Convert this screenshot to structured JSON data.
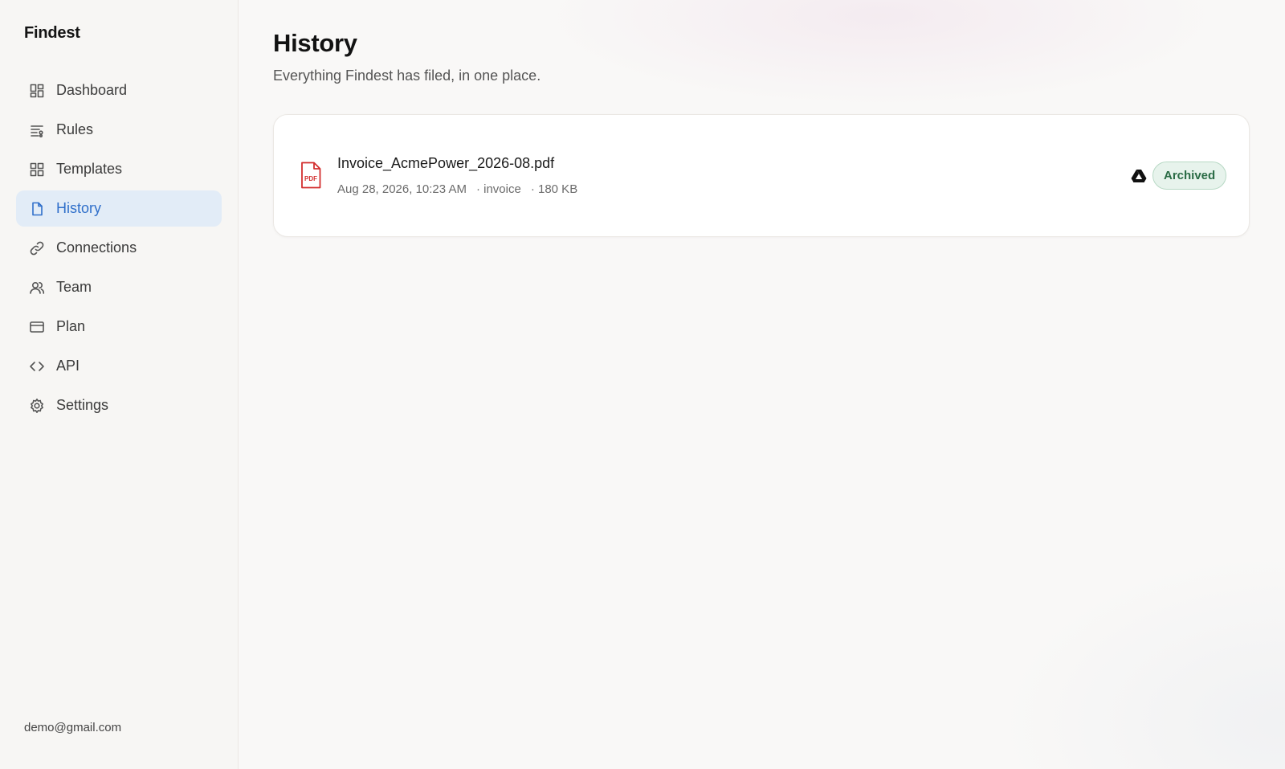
{
  "app": {
    "brand": "Findest"
  },
  "sidebar": {
    "items": [
      {
        "label": "Dashboard",
        "icon": "dashboard-icon",
        "active": false
      },
      {
        "label": "Rules",
        "icon": "rules-icon",
        "active": false
      },
      {
        "label": "Templates",
        "icon": "templates-icon",
        "active": false
      },
      {
        "label": "History",
        "icon": "file-icon",
        "active": true
      },
      {
        "label": "Connections",
        "icon": "link-icon",
        "active": false
      },
      {
        "label": "Team",
        "icon": "users-icon",
        "active": false
      },
      {
        "label": "Plan",
        "icon": "credit-card-icon",
        "active": false
      },
      {
        "label": "API",
        "icon": "code-icon",
        "active": false
      },
      {
        "label": "Settings",
        "icon": "gear-icon",
        "active": false
      }
    ],
    "user_email": "demo@gmail.com"
  },
  "main": {
    "title": "History",
    "subtitle": "Everything Findest has filed, in one place.",
    "entries": [
      {
        "file_name": "Invoice_AcmePower_2026-08.pdf",
        "date": "Aug 28, 2026, 10:23 AM",
        "type": "· invoice",
        "size": "· 180 KB",
        "file_icon": "pdf-icon",
        "destination_icon": "google-drive-icon",
        "status": "Archived"
      }
    ]
  },
  "colors": {
    "accent": "#2f6fca",
    "active_bg": "#e2ecf7",
    "status_green": "#2a6b45",
    "status_green_bg": "#e7f3ec",
    "pdf_red": "#d32f2f"
  }
}
